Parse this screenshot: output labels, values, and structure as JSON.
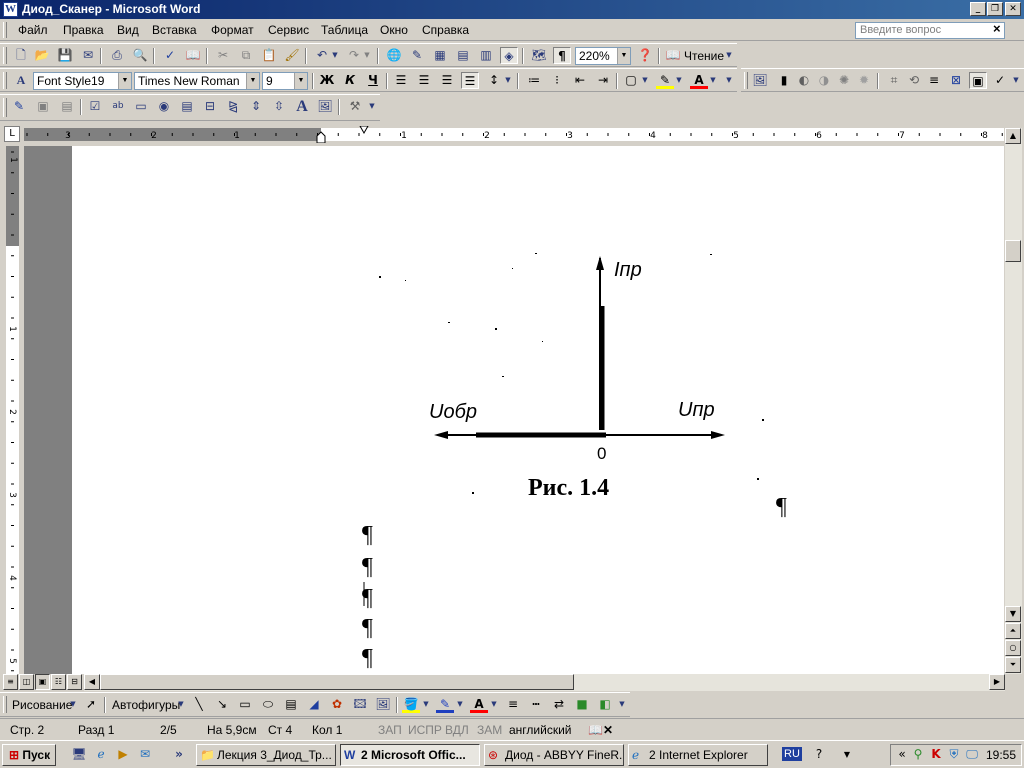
{
  "window": {
    "title": "Диод_Сканер - Microsoft Word",
    "app_icon": "W"
  },
  "menu": {
    "items": [
      "Файл",
      "Правка",
      "Вид",
      "Вставка",
      "Формат",
      "Сервис",
      "Таблица",
      "Окно",
      "Справка"
    ],
    "help_placeholder": "Введите вопрос"
  },
  "toolbar_standard": {
    "zoom": "220%",
    "read_label": "Чтение"
  },
  "toolbar_formatting": {
    "style": "Font Style19",
    "font": "Times New Roman",
    "size": "9",
    "bold": "Ж",
    "italic": "К",
    "underline": "Ч"
  },
  "rulers": {
    "corner": "L",
    "h_labels": [
      "3",
      "2",
      "1",
      "1",
      "2",
      "3",
      "4",
      "5",
      "6",
      "7",
      "8"
    ],
    "v_labels": [
      "1",
      "1",
      "2",
      "3",
      "4",
      "5"
    ]
  },
  "document": {
    "figure": {
      "y_axis_label": "Iпр",
      "x_pos_label": "Uпр",
      "x_neg_label": "Uобр",
      "origin_label": "0",
      "caption": "Рис. 1.4"
    },
    "pilcrow": "¶"
  },
  "drawing_toolbar": {
    "draw_menu": "Рисование",
    "autoshapes_menu": "Автофигуры"
  },
  "statusbar": {
    "page": "Стр. 2",
    "section": "Разд 1",
    "page_of": "2/5",
    "at": "На 5,9см",
    "line": "Ст 4",
    "col": "Кол 1",
    "rec": "ЗАП",
    "trk": "ИСПР",
    "ext": "ВДЛ",
    "ovr": "ЗАМ",
    "language": "английский"
  },
  "taskbar": {
    "start": "Пуск",
    "tasks": [
      {
        "label": "Лекция 3_Диод_Тр...",
        "icon": "folder-icon"
      },
      {
        "label": "2 Microsoft Offic...",
        "icon": "word-icon"
      },
      {
        "label": "Диод - ABBYY FineR...",
        "icon": "abbyy-icon"
      },
      {
        "label": "2 Internet Explorer",
        "icon": "ie-icon"
      }
    ],
    "lang_indicator": "RU",
    "clock": "19:55"
  },
  "colors": {
    "title_bar": "#0a246a",
    "face": "#d4d0c8",
    "page": "#ffffff",
    "workspace": "#808080"
  }
}
